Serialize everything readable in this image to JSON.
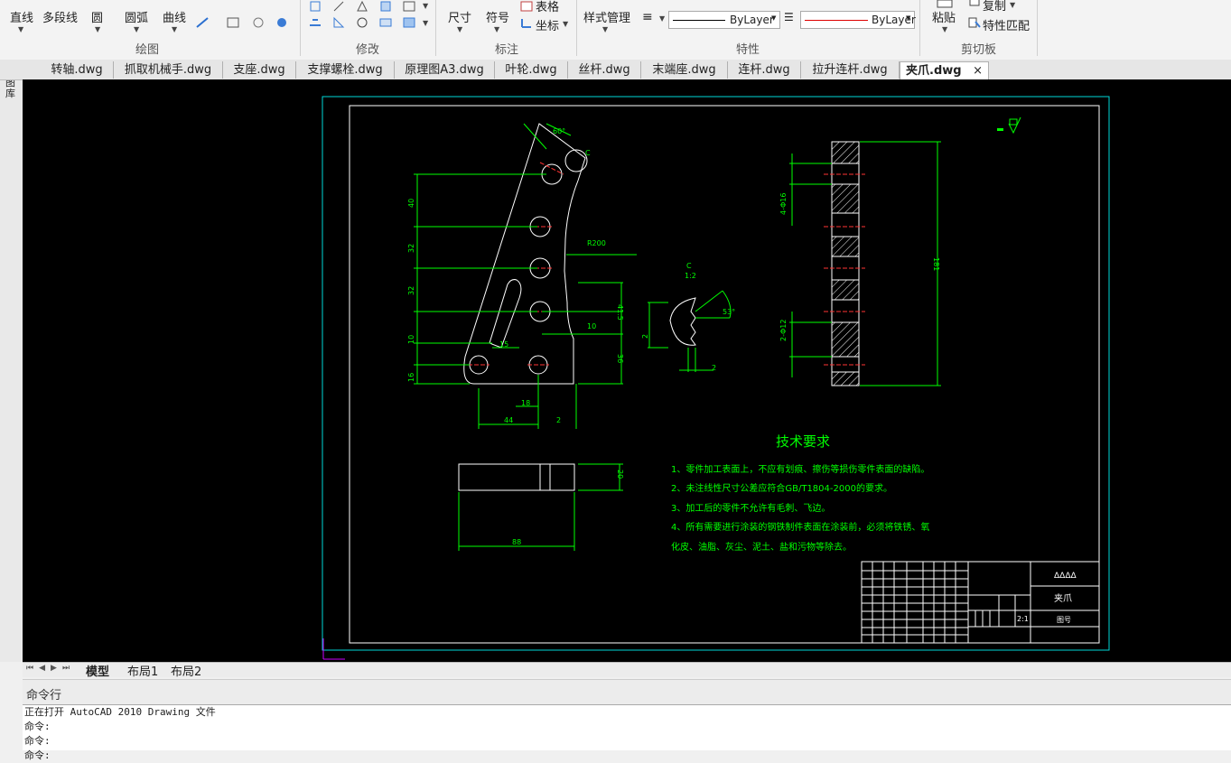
{
  "ribbon": {
    "draw": {
      "line": "直线",
      "polyline": "多段线",
      "circle": "圆",
      "arc": "圆弧",
      "curve": "曲线",
      "group": "绘图"
    },
    "modify": {
      "group": "修改"
    },
    "annotate": {
      "dimension": "尺寸",
      "symbol": "符号",
      "table": "表格",
      "coordinate": "坐标",
      "group": "标注"
    },
    "properties": {
      "style_manager": "样式管理",
      "linetype": "ByLayer",
      "lineweight": "ByLayer",
      "group": "特性"
    },
    "clipboard": {
      "paste": "粘贴",
      "copy": "复制",
      "match": "特性匹配",
      "group": "剪切板"
    }
  },
  "tabs": [
    {
      "label": "转轴.dwg"
    },
    {
      "label": "抓取机械手.dwg"
    },
    {
      "label": "支座.dwg"
    },
    {
      "label": "支撑螺栓.dwg"
    },
    {
      "label": "原理图A3.dwg"
    },
    {
      "label": "叶轮.dwg"
    },
    {
      "label": "丝杆.dwg"
    },
    {
      "label": "末端座.dwg"
    },
    {
      "label": "连杆.dwg"
    },
    {
      "label": "拉升连杆.dwg"
    },
    {
      "label": "夹爪.dwg"
    }
  ],
  "close_glyph": "×",
  "side_label": "图库",
  "layout_tabs": {
    "model": "模型",
    "layout1": "布局1",
    "layout2": "布局2"
  },
  "drawing": {
    "tech_title": "技术要求",
    "req1": "1、零件加工表面上，不应有划痕、擦伤等损伤零件表面的缺陷。",
    "req2": "2、未注线性尺寸公差应符合GB/T1804-2000的要求。",
    "req3": "3、加工后的零件不允许有毛刺、飞边。",
    "req4a": "4、所有需要进行涂装的钢铁制件表面在涂装前，必须将铁锈、氧",
    "req4b": "化皮、油脂、灰尘、泥土、盐和污物等除去。",
    "part_name": "夹爪",
    "scale": "2:1",
    "title_mark": "ΔΔΔΔ",
    "drawing_no": "图号",
    "dims": {
      "d60": "60°",
      "dC": "C",
      "dR200": "R200",
      "d40": "40",
      "d32a": "32",
      "d32b": "32",
      "d10": "10",
      "d16": "16",
      "d15": "15",
      "d18": "18",
      "d44": "44",
      "d2": "2",
      "d41": "41.5",
      "d10b": "10",
      "d36": "36",
      "d20": "20",
      "d88": "88",
      "dC2": "C",
      "d12": "1:2",
      "d53": "53°",
      "d2b": "2",
      "d2c": "2",
      "d4phi16": "4-Φ16",
      "d2phi12": "2-Φ12",
      "d181": "181"
    }
  },
  "cmd": {
    "header": "命令行",
    "lines": [
      "正在打开 AutoCAD 2010 Drawing 文件",
      "命令:",
      "命令:",
      "命令:"
    ]
  }
}
